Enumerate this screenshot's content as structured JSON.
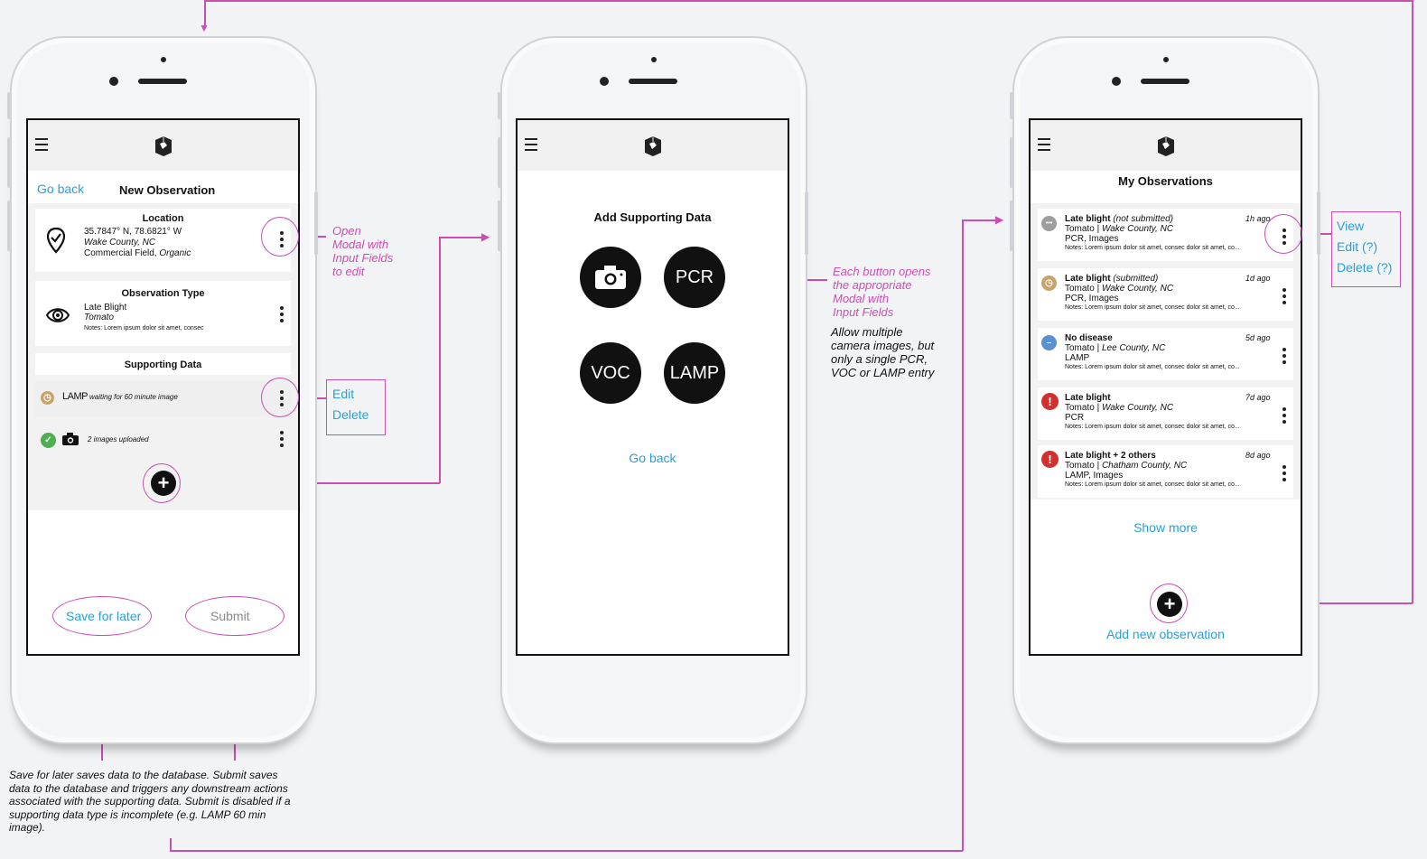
{
  "colors": {
    "accent_blue": "#2a9fd6",
    "annotation_pink": "#c94fb3",
    "alert_red": "#d32f2f",
    "pending_tan": "#c9a46a",
    "ok_green": "#4caf50",
    "neutral_gray": "#9e9e9e",
    "info_blue": "#5b8fd4"
  },
  "screen1": {
    "back": "Go back",
    "title": "New Observation",
    "location": {
      "heading": "Location",
      "coords": "35.7847° N, 78.6821° W",
      "county": "Wake County, NC",
      "field_prefix": "Commercial Field, ",
      "field_type": "Organic"
    },
    "obs_type": {
      "heading": "Observation Type",
      "disease": "Late Blight",
      "crop": "Tomato",
      "notes": "Notes: Lorem ipsum dolor sit amet, consec"
    },
    "supporting": {
      "heading": "Supporting Data",
      "lamp_label": "LAMP",
      "lamp_status": "waiting for 60 minute image",
      "images_status": "2 images uploaded"
    },
    "save_later": "Save for later",
    "submit": "Submit"
  },
  "screen2": {
    "title": "Add Supporting Data",
    "buttons": {
      "pcr": "PCR",
      "voc": "VOC",
      "lamp": "LAMP"
    },
    "back": "Go back"
  },
  "screen3": {
    "title": "My Observations",
    "items": [
      {
        "title": "Late blight",
        "title_note": "(not submitted)",
        "crop": "Tomato",
        "county": "Wake County, NC",
        "data": "PCR, Images",
        "notes": "Notes: Lorem ipsum dolor sit amet, consec  dolor sit amet, co...",
        "time": "1h ago",
        "status": "pending",
        "glyph": "•••"
      },
      {
        "title": "Late blight",
        "title_note": "(submitted)",
        "crop": "Tomato",
        "county": "Wake County, NC",
        "data": "PCR, Images",
        "notes": "Notes: Lorem ipsum dolor sit amet, consec  dolor sit amet, co...",
        "time": "1d ago",
        "status": "waiting",
        "glyph": "◷"
      },
      {
        "title": "No disease",
        "title_note": "",
        "crop": "Tomato",
        "county": "Lee County, NC",
        "data": "LAMP",
        "notes": "Notes: Lorem ipsum dolor sit amet, consec  dolor sit amet, co...",
        "time": "5d ago",
        "status": "none",
        "glyph": "–"
      },
      {
        "title": "Late blight",
        "title_note": "",
        "crop": "Tomato",
        "county": "Wake County, NC",
        "data": "PCR",
        "notes": "Notes: Lorem ipsum dolor sit amet, consec  dolor sit amet, co...",
        "time": "7d ago",
        "status": "alert",
        "glyph": "!"
      },
      {
        "title": "Late blight + 2 others",
        "title_note": "",
        "crop": "Tomato",
        "county": "Chatham County, NC",
        "data": "LAMP, Images",
        "notes": "Notes: Lorem ipsum dolor sit amet, consec  dolor sit amet, co...",
        "time": "8d ago",
        "status": "alert",
        "glyph": "!"
      }
    ],
    "show_more": "Show more",
    "add_new": "Add new observation"
  },
  "annotations": {
    "open_modal": [
      "Open",
      "Modal with",
      "Input Fields",
      "to edit"
    ],
    "edit": "Edit",
    "delete": "Delete",
    "each_button": [
      "Each button opens",
      "the appropriate",
      "Modal with",
      "Input Fields"
    ],
    "allow_multiple": [
      "Allow multiple",
      "camera images, but",
      "only a single PCR,",
      "VOC or LAMP entry"
    ],
    "view": "View",
    "edit_q": "Edit (?)",
    "delete_q": "Delete (?)",
    "save_note": [
      "Save for later saves data to the database. Submit saves",
      "data to the database and triggers any downstream actions",
      "associated with the supporting data. Submit is disabled if a",
      "supporting data type is incomplete (e.g. LAMP 60 min",
      "image)."
    ]
  }
}
